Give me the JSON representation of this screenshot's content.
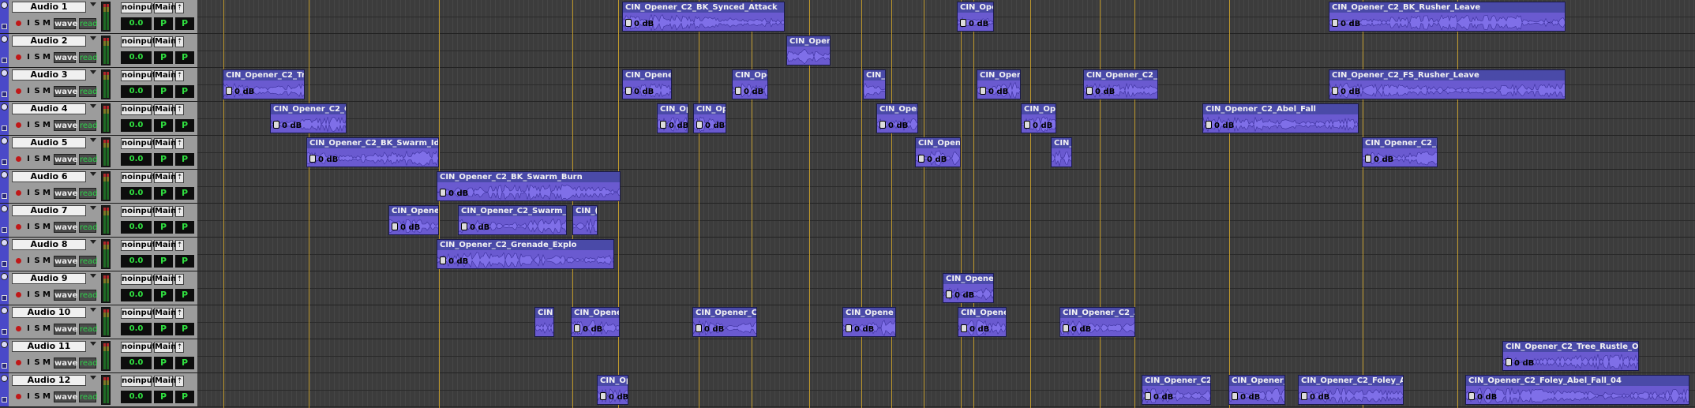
{
  "session": {
    "accent_color": "#4a49c8",
    "clip_color": "#6656c8",
    "grid_color": "#cfa42a"
  },
  "track_defaults": {
    "rec_label": "●",
    "input_label": "I",
    "solo_label": "S",
    "mute_label": "M",
    "view_label": "wave",
    "automation_label": "read",
    "input_route": "noinput",
    "output_route": "Main",
    "volume": "0.0",
    "pan_left": "P",
    "pan_right": "P"
  },
  "tracks": [
    {
      "name": "Audio 1"
    },
    {
      "name": "Audio 2"
    },
    {
      "name": "Audio 3"
    },
    {
      "name": "Audio 4"
    },
    {
      "name": "Audio 5"
    },
    {
      "name": "Audio 6"
    },
    {
      "name": "Audio 7"
    },
    {
      "name": "Audio 8"
    },
    {
      "name": "Audio 9"
    },
    {
      "name": "Audio 10"
    },
    {
      "name": "Audio 11"
    },
    {
      "name": "Audio 12"
    }
  ],
  "clips": [
    {
      "track": 0,
      "name": "CIN_Opener_C2_BK_Synced_Attack",
      "gain": "0 dB"
    },
    {
      "track": 0,
      "name": "CIN_Ope",
      "gain": "0 dB"
    },
    {
      "track": 0,
      "name": "CIN_Opener_C2_BK_Rusher_Leave",
      "gain": "0 dB"
    },
    {
      "track": 1,
      "name": "CIN_Open",
      "gain": ""
    },
    {
      "track": 2,
      "name": "CIN_Opener_C2_Tre",
      "gain": "0 dB"
    },
    {
      "track": 2,
      "name": "CIN_Opene",
      "gain": "0 dB"
    },
    {
      "track": 2,
      "name": "CIN_Ope",
      "gain": "0 dB"
    },
    {
      "track": 2,
      "name": "CIN_",
      "gain": ""
    },
    {
      "track": 2,
      "name": "CIN_Oper",
      "gain": "0 dB"
    },
    {
      "track": 2,
      "name": "CIN_Opener_C2_R",
      "gain": "0 dB"
    },
    {
      "track": 2,
      "name": "CIN_Opener_C2_FS_Rusher_Leave",
      "gain": "0 dB"
    },
    {
      "track": 3,
      "name": "CIN_Opener_C2_G",
      "gain": "0 dB"
    },
    {
      "track": 3,
      "name": "CIN_Op",
      "gain": "0 dB"
    },
    {
      "track": 3,
      "name": "CIN_Op",
      "gain": "0 dB"
    },
    {
      "track": 3,
      "name": "CIN_Opene",
      "gain": "0 dB"
    },
    {
      "track": 3,
      "name": "CIN_Ope",
      "gain": "0 dB"
    },
    {
      "track": 3,
      "name": "CIN_Opener_C2_Abel_Fall",
      "gain": "0 dB"
    },
    {
      "track": 4,
      "name": "CIN_Opener_C2_BK_Swarm_Idle",
      "gain": "0 dB"
    },
    {
      "track": 4,
      "name": "CIN_Opene",
      "gain": "0 dB"
    },
    {
      "track": 4,
      "name": "CIN_",
      "gain": ""
    },
    {
      "track": 4,
      "name": "CIN_Opener_C2_B",
      "gain": "0 dB"
    },
    {
      "track": 5,
      "name": "CIN_Opener_C2_BK_Swarm_Burn",
      "gain": "0 dB"
    },
    {
      "track": 6,
      "name": "CIN_Opener",
      "gain": "0 dB"
    },
    {
      "track": 6,
      "name": "CIN_Opener_C2_Swarm_Bc",
      "gain": "0 dB"
    },
    {
      "track": 6,
      "name": "CIN_(",
      "gain": ""
    },
    {
      "track": 7,
      "name": "CIN_Opener_C2_Grenade_Explo",
      "gain": "0 dB"
    },
    {
      "track": 8,
      "name": "CIN_Opener",
      "gain": "0 dB"
    },
    {
      "track": 9,
      "name": "CIN_",
      "gain": ""
    },
    {
      "track": 9,
      "name": "CIN_Opener",
      "gain": "0 dB"
    },
    {
      "track": 9,
      "name": "CIN_Opener_C2",
      "gain": "0 dB"
    },
    {
      "track": 9,
      "name": "CIN_Opene",
      "gain": "0 dB"
    },
    {
      "track": 9,
      "name": "CIN_Opene",
      "gain": "0 dB"
    },
    {
      "track": 9,
      "name": "CIN_Opener_C2_A",
      "gain": "0 dB"
    },
    {
      "track": 10,
      "name": "CIN_Opener_C2_Tree_Rustle_Outs",
      "gain": "0 dB"
    },
    {
      "track": 11,
      "name": "CIN_Op",
      "gain": "0 dB"
    },
    {
      "track": 11,
      "name": "CIN_Opener_C2",
      "gain": "0 dB"
    },
    {
      "track": 11,
      "name": "CIN_Opener_C",
      "gain": "0 dB"
    },
    {
      "track": 11,
      "name": "CIN_Opener_C2_Foley_Ab",
      "gain": "0 dB"
    },
    {
      "track": 11,
      "name": "CIN_Opener_C2_Foley_Abel_Fall_04",
      "gain": "0 dB"
    }
  ]
}
